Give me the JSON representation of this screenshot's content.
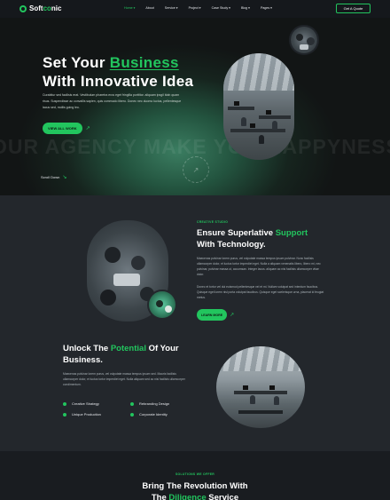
{
  "nav": {
    "logo_prefix": "Soft",
    "logo_accent": "co",
    "logo_suffix": "nic",
    "items": [
      {
        "label": "Home ▾",
        "active": true
      },
      {
        "label": "About",
        "active": false
      },
      {
        "label": "Service ▾",
        "active": false
      },
      {
        "label": "Project ▾",
        "active": false
      },
      {
        "label": "Case Study ▾",
        "active": false
      },
      {
        "label": "Blog ▾",
        "active": false
      },
      {
        "label": "Pages ▾",
        "active": false
      }
    ],
    "cta": "Get A Quote"
  },
  "hero": {
    "title_prefix": "Set Your ",
    "title_accent": "Business",
    "title_line2": "With Innovative Idea",
    "description": "Curabitur sed facilisis erat. Vestibulum pharetra eros eget fringilla porttitor. aliquam ipsgil blah quam risus. Suspendisse ac convallis sapien, quis commodo libero. Donec nec duomo luctus, pellentesque lacus sed, mollis going leo.",
    "view_btn": "VIEW ALL WORK",
    "marquee": "OUR AGENCY MAKE YOU HAPPYNESS",
    "scroll_down": "Scroll Down",
    "badge_text": "PROJECT · CREATIVE · STUDIO"
  },
  "support": {
    "kicker": "CREATIVE STUDIO",
    "title_prefix": "Ensure Superlative ",
    "title_accent": "Support",
    "title_line2": "With Technology.",
    "para1": "Maecenas pulvinar lorem purus, vel vulputate massa tempus ipsum pulvinar. Nunc facilisis ullamcorper dolor, et luctus tortor imperdiet eget. Nulla a aliquam venenatis libero, libero mi, nec pulvinar, pulvinar massa ut, accumsan. Integer lacus. aliquam ac nisi facilisis ullamcorper vitae dolor.",
    "para2": "Donec et tortor vel dui euismod pellentesque vel et mi. Nullam volutpat sed interdum faucibus. Quisque eget lorem nisl porta volutpat faucibus. Quisque eget scelerisque urna, placerat id feugiat metus.",
    "learn_btn": "LEARN MORE"
  },
  "potential": {
    "title_prefix": "Unlock The ",
    "title_accent": "Potential",
    "title_suffix": " Of Your",
    "title_line2": "Business.",
    "para": "Maecenas pulvinar lorem purus, vel vulputate massa tempus ipsum sed. Mauris facilisis ullamcorper dolor, et luctus tortor imperdiet eget. Nulla aliquam sed ac nisi facilisis ullamcorper condimentum.",
    "list": [
      "Creative Strategy",
      "Rebranding Design",
      "Unique Production",
      "Corporate Identity"
    ]
  },
  "revolution": {
    "kicker": "SOLUTIONS WE OFFER",
    "title_line1": "Bring The Revolution With",
    "title_prefix": "The ",
    "title_accent": "Diligence",
    "title_suffix": " Service"
  },
  "colors": {
    "accent": "#22c55e",
    "bg_dark": "#1f2328",
    "nav_bg": "#15181c"
  }
}
